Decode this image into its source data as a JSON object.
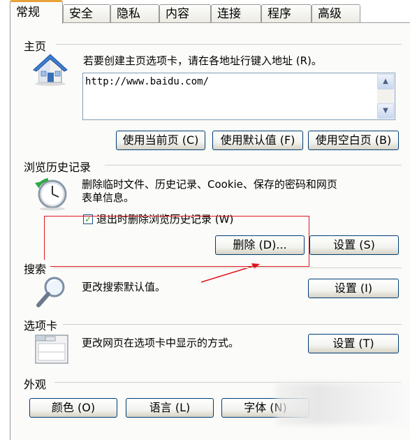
{
  "tabs": [
    {
      "label": "常规",
      "active": true
    },
    {
      "label": "安全"
    },
    {
      "label": "隐私"
    },
    {
      "label": "内容"
    },
    {
      "label": "连接"
    },
    {
      "label": "程序"
    },
    {
      "label": "高级"
    }
  ],
  "homepage": {
    "section_title": "主页",
    "instruction": "若要创建主页选项卡，请在各地址行键入地址 (R)。",
    "url_value": "http://www.baidu.com/",
    "buttons": {
      "use_current": "使用当前页 (C)",
      "use_default": "使用默认值 (F)",
      "use_blank": "使用空白页 (B)"
    }
  },
  "history": {
    "section_title": "浏览历史记录",
    "description_line1": "删除临时文件、历史记录、Cookie、保存的密码和网页",
    "description_line2": "表单信息。",
    "checkbox_label": "退出时删除浏览历史记录 (W)",
    "checkbox_checked": true,
    "delete_button": "删除 (D)...",
    "settings_button": "设置 (S)"
  },
  "search": {
    "section_title": "搜索",
    "description": "更改搜索默认值。",
    "settings_button": "设置 (I)"
  },
  "tabs_section": {
    "section_title": "选项卡",
    "description": "更改网页在选项卡中显示的方式。",
    "settings_button": "设置 (T)"
  },
  "appearance": {
    "section_title": "外观",
    "buttons": {
      "colors": "颜色 (O)",
      "languages": "语言 (L)",
      "fonts": "字体 (N)"
    }
  },
  "colors": {
    "tab_accent": "#e8a23a",
    "annotation_red": "#e0141c",
    "button_border": "#003c74"
  }
}
